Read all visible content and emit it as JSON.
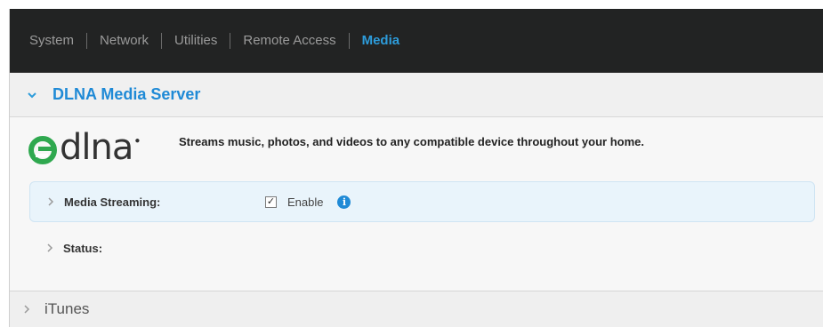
{
  "nav": {
    "items": [
      {
        "label": "System"
      },
      {
        "label": "Network"
      },
      {
        "label": "Utilities"
      },
      {
        "label": "Remote Access"
      },
      {
        "label": "Media"
      }
    ],
    "active": "Media"
  },
  "dlna_section": {
    "title": "DLNA Media Server",
    "logo_text": "dlna",
    "description": "Streams music, photos, and videos to any compatible device throughout your home.",
    "rows": {
      "media_streaming": {
        "label": "Media Streaming:",
        "checkbox_checked": true,
        "checkbox_label": "Enable",
        "info_icon": "i"
      },
      "status": {
        "label": "Status:"
      }
    }
  },
  "itunes_section": {
    "title": "iTunes"
  },
  "colors": {
    "accent": "#1f8ad6",
    "nav_bg": "#222323",
    "highlight_row": "#e9f4fb"
  }
}
